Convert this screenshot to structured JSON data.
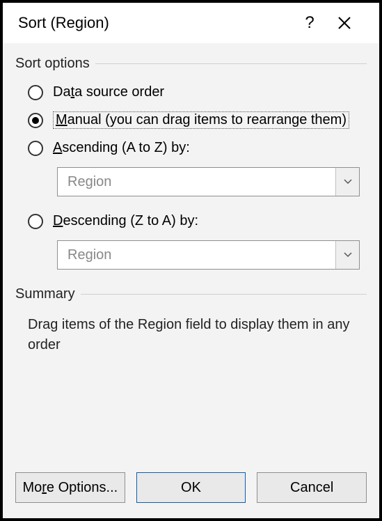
{
  "title": "Sort (Region)",
  "groups": {
    "sort_options_label": "Sort options",
    "summary_label": "Summary"
  },
  "radios": {
    "data_source_pre": "Da",
    "data_source_u": "t",
    "data_source_post": "a source order",
    "manual_u": "M",
    "manual_post": "anual (you can drag items to rearrange them)",
    "ascending_u": "A",
    "ascending_post": "scending (A to Z) by:",
    "descending_u": "D",
    "descending_post": "escending (Z to A) by:"
  },
  "dropdowns": {
    "ascending_value": "Region",
    "descending_value": "Region"
  },
  "summary_text": "Drag items of the Region field to display them in any order",
  "buttons": {
    "more_options_pre": "Mo",
    "more_options_u": "r",
    "more_options_post": "e Options...",
    "ok": "OK",
    "cancel": "Cancel"
  },
  "selected_radio": "manual"
}
